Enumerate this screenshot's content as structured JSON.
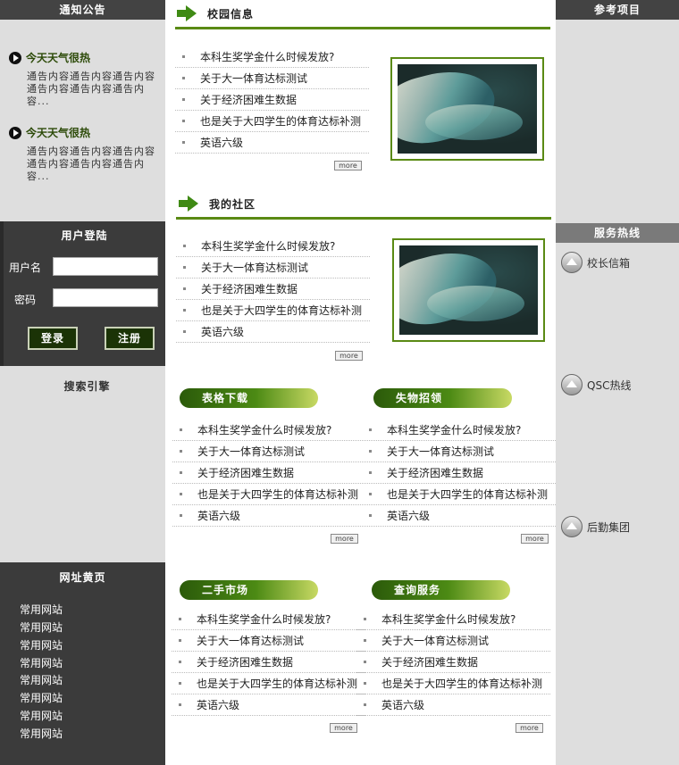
{
  "left": {
    "notice_title": "通知公告",
    "notices": [
      {
        "title": "今天天气很热",
        "body": "通告内容通告内容通告内容通告内容通告内容通告内容..."
      },
      {
        "title": "今天天气很热",
        "body": "通告内容通告内容通告内容通告内容通告内容通告内容..."
      }
    ],
    "login": {
      "title": "用户登陆",
      "username_label": "用户名",
      "password_label": "密码",
      "login_button": "登录",
      "register_button": "注册"
    },
    "search_title": "搜索引擎",
    "links_title": "网址黄页",
    "links": [
      "常用网站",
      "常用网站",
      "常用网站",
      "常用网站",
      "常用网站",
      "常用网站",
      "常用网站",
      "常用网站"
    ]
  },
  "right": {
    "ref_title": "参考项目",
    "service_title": "服务热线",
    "services": [
      "校长信箱",
      "QSC热线",
      "后勤集团"
    ]
  },
  "main": {
    "campus": {
      "title": "校园信息",
      "items": [
        "本科生奖学金什么时候发放?",
        "关于大一体育达标测试",
        "关于经济困难生数据",
        "也是关于大四学生的体育达标补测",
        "英语六级"
      ],
      "more": "more"
    },
    "community": {
      "title": "我的社区",
      "items": [
        "本科生奖学金什么时候发放?",
        "关于大一体育达标测试",
        "关于经济困难生数据",
        "也是关于大四学生的体育达标补测",
        "英语六级"
      ],
      "more": "more"
    },
    "downloads": {
      "title": "表格下载",
      "items": [
        "本科生奖学金什么时候发放?",
        "关于大一体育达标测试",
        "关于经济困难生数据",
        "也是关于大四学生的体育达标补测",
        "英语六级"
      ],
      "more": "more"
    },
    "lostfound": {
      "title": "失物招领",
      "items": [
        "本科生奖学金什么时候发放?",
        "关于大一体育达标测试",
        "关于经济困难生数据",
        "也是关于大四学生的体育达标补测",
        "英语六级"
      ],
      "more": "more"
    },
    "market": {
      "title": "二手市场",
      "items": [
        "本科生奖学金什么时候发放?",
        "关于大一体育达标测试",
        "关于经济困难生数据",
        "也是关于大四学生的体育达标补测",
        "英语六级"
      ],
      "more": "more"
    },
    "query": {
      "title": "查询服务",
      "items": [
        "本科生奖学金什么时候发放?",
        "关于大一体育达标测试",
        "关于经济困难生数据",
        "也是关于大四学生的体育达标补测",
        "英语六级"
      ],
      "more": "more"
    }
  },
  "colors": {
    "accent": "#5a8a14",
    "dark": "#3b3b3b",
    "sidebar": "#dedede"
  }
}
